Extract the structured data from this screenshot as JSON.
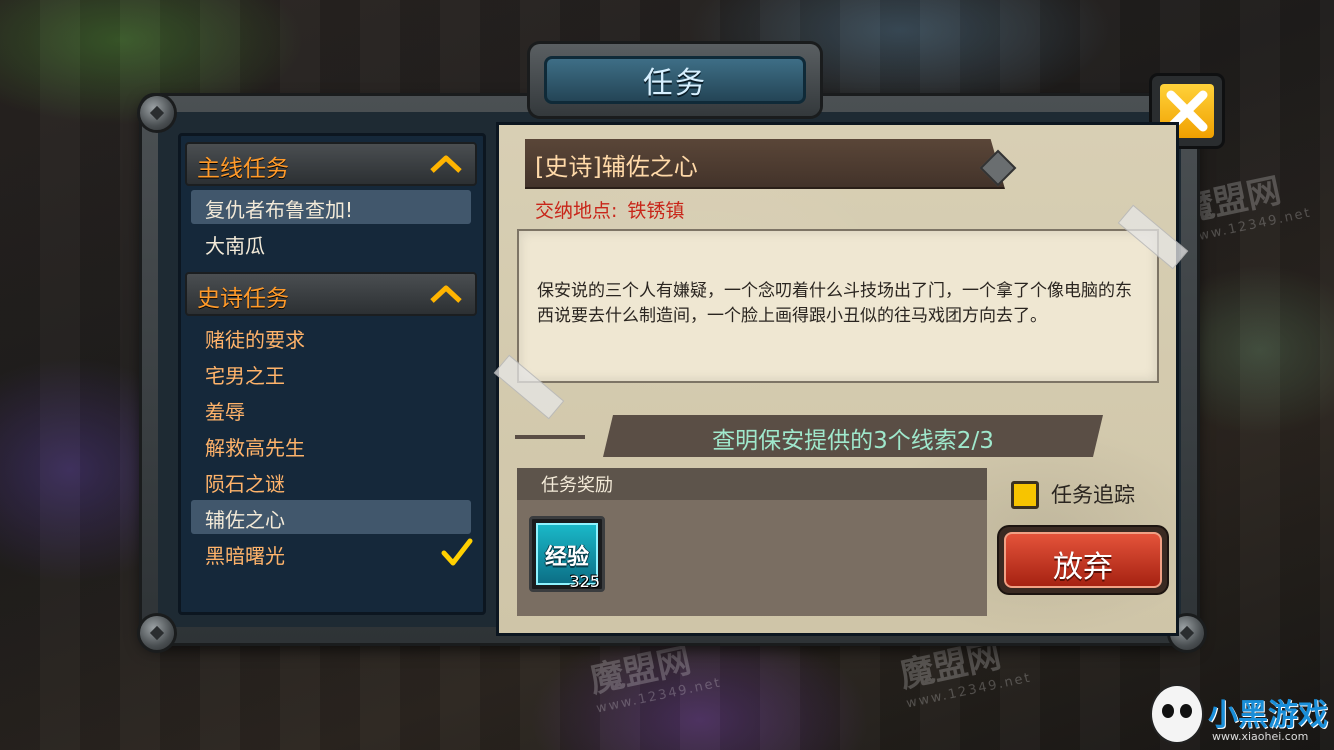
{
  "window_title": "任务",
  "categories": [
    {
      "label": "主线任务",
      "items": [
        {
          "label": "复仇者布鲁查加!",
          "selected": true
        },
        {
          "label": "大南瓜",
          "selected": false
        }
      ]
    },
    {
      "label": "史诗任务",
      "items": [
        {
          "label": "赌徒的要求",
          "selected": false,
          "completed": false
        },
        {
          "label": "宅男之王",
          "selected": false,
          "completed": false
        },
        {
          "label": "羞辱",
          "selected": false,
          "completed": false
        },
        {
          "label": "解救高先生",
          "selected": false,
          "completed": false
        },
        {
          "label": "陨石之谜",
          "selected": false,
          "completed": false
        },
        {
          "label": "辅佐之心",
          "selected": true,
          "completed": false
        },
        {
          "label": "黑暗曙光",
          "selected": false,
          "completed": true
        }
      ]
    }
  ],
  "detail": {
    "title": "[史诗]辅佐之心",
    "location_label": "交纳地点:",
    "location_value": "铁锈镇",
    "description": "保安说的三个人有嫌疑，一个念叨着什么斗技场出了门，一个拿了个像电脑的东西说要去什么制造间，一个脸上画得跟小丑似的往马戏团方向去了。",
    "objective": "查明保安提供的3个线索2/3",
    "reward_header": "任务奖励",
    "reward": {
      "name": "经验",
      "amount": "325"
    },
    "track_label": "任务追踪",
    "track_checked": true,
    "abandon_label": "放弃"
  },
  "watermark": {
    "name": "魔盟网",
    "url": "www.12349.net"
  },
  "corner_logo": {
    "name": "小黑游戏",
    "url": "www.xiaohei.com"
  },
  "colors": {
    "accent_orange": "#ff9a2a",
    "close_yellow": "#ffc400",
    "abandon_red": "#c8321d",
    "objective_teal": "#9fe8cc"
  }
}
